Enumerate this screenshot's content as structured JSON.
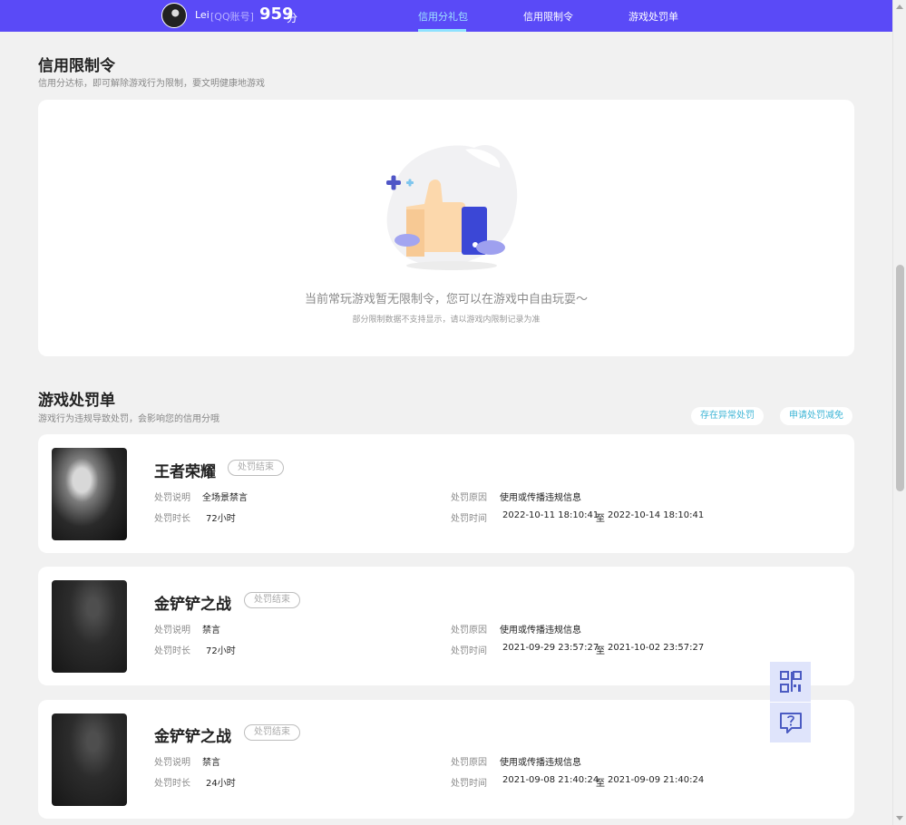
{
  "header": {
    "user_name": "Lei",
    "account_type": "[QQ账号]",
    "score": "959",
    "score_unit": "分",
    "tabs": [
      {
        "label": "信用分礼包",
        "active": true
      },
      {
        "label": "信用限制令",
        "active": false
      },
      {
        "label": "游戏处罚单",
        "active": false
      }
    ]
  },
  "restriction": {
    "title": "信用限制令",
    "subtitle": "信用分达标，即可解除游戏行为限制，要文明健康地游戏",
    "empty_main": "当前常玩游戏暂无限制令，您可以在游戏中自由玩耍～",
    "empty_sub": "部分限制数据不支持显示，请以游戏内限制记录为准"
  },
  "penalty": {
    "title": "游戏处罚单",
    "subtitle": "游戏行为违规导致处罚，会影响您的信用分哦",
    "btn_abnormal": "存在异常处罚",
    "btn_appeal": "申请处罚减免",
    "labels": {
      "desc": "处罚说明",
      "duration": "处罚时长",
      "reason": "处罚原因",
      "time": "处罚时间",
      "to": "至"
    },
    "records": [
      {
        "game": "王者荣耀",
        "status": "处罚结束",
        "desc": "全场景禁言",
        "duration": "72小时",
        "reason": "使用或传播违规信息",
        "start": "2022-10-11 18:10:41",
        "end": "2022-10-14 18:10:41"
      },
      {
        "game": "金铲铲之战",
        "status": "处罚结束",
        "desc": "禁言",
        "duration": "72小时",
        "reason": "使用或传播违规信息",
        "start": "2021-09-29 23:57:27",
        "end": "2021-10-02 23:57:27"
      },
      {
        "game": "金铲铲之战",
        "status": "处罚结束",
        "desc": "禁言",
        "duration": "24小时",
        "reason": "使用或传播违规信息",
        "start": "2021-09-08 21:40:24",
        "end": "2021-09-09 21:40:24"
      }
    ]
  },
  "icons": {
    "qr": "qr-code-icon",
    "feedback": "help-message-icon"
  },
  "colors": {
    "topbar": "#5a4af7",
    "active_tab": "#9ee3ff",
    "accent_link": "#3fb6d6"
  }
}
